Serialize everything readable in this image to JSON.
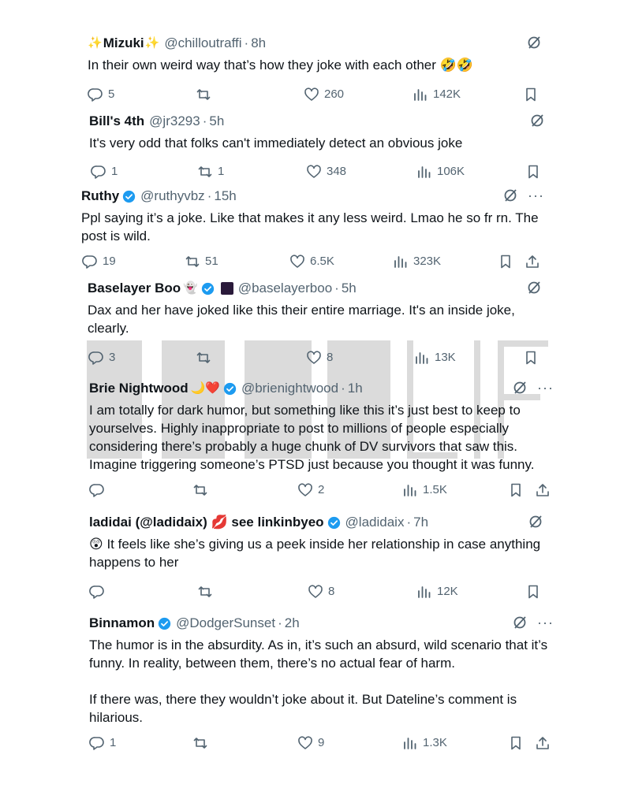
{
  "posts": [
    {
      "name": "Mizuki",
      "name_prefix_emoji": "✨",
      "name_suffix_emoji": "✨",
      "handle": "@chilloutraffi",
      "time": "8h",
      "text": "In their own weird way that’s how they joke with each other 🤣🤣",
      "replies": "5",
      "reposts": "",
      "likes": "260",
      "views": "142K",
      "verified": false,
      "show_more": false,
      "show_share": false
    },
    {
      "name": "Bill's 4th",
      "handle": "@jr3293",
      "time": "5h",
      "text": "It's very odd that folks can't immediately detect an obvious joke",
      "replies": "1",
      "reposts": "1",
      "likes": "348",
      "views": "106K",
      "verified": false,
      "show_more": false,
      "show_share": false
    },
    {
      "name": "Ruthy",
      "handle": "@ruthyvbz",
      "time": "15h",
      "text": "Ppl saying it’s a joke. Like that makes it any less weird. Lmao he so fr rn. The post is wild.",
      "replies": "19",
      "reposts": "51",
      "likes": "6.5K",
      "views": "323K",
      "verified": true,
      "show_more": true,
      "show_share": true
    },
    {
      "name": "Baselayer Boo",
      "name_suffix_emoji": "👻",
      "handle": "@baselayerboo",
      "time": "5h",
      "text": "Dax and her have joked like this their entire marriage. It's an inside joke, clearly.",
      "replies": "3",
      "reposts": "",
      "likes": "8",
      "views": "13K",
      "verified": true,
      "show_more": false,
      "show_share": false
    },
    {
      "name": "Brie Nightwood",
      "name_suffix_emoji": "🌙❤️",
      "handle": "@brienightwood",
      "time": "1h",
      "text": "I am totally for dark humor, but something like this it’s just best to keep to yourselves. Highly inappropriate to post to millions of people especially considering there’s probably a huge chunk of DV survivors that saw this. Imagine triggering someone’s PTSD just because you thought it was funny.",
      "replies": "",
      "reposts": "",
      "likes": "2",
      "views": "1.5K",
      "verified": true,
      "show_more": true,
      "show_share": true
    },
    {
      "name": "ladidai (@ladidaix) 💋 see linkinbyeo",
      "handle": "@ladidaix",
      "time": "7h",
      "text": "😲 It feels like she’s giving us a peek inside her relationship in case anything happens to her",
      "replies": "",
      "reposts": "",
      "likes": "8",
      "views": "12K",
      "verified": true,
      "show_more": false,
      "show_share": false
    },
    {
      "name": "Binnamon",
      "handle": "@DodgerSunset",
      "time": "2h",
      "text": "The humor is in the absurdity. As in, it’s such an absurd, wild scenario that it’s funny. In reality, between them, there’s no actual fear of harm.\n\nIf there was, there they wouldn’t joke about it. But Dateline’s comment is hilarious.",
      "replies": "1",
      "reposts": "",
      "likes": "9",
      "views": "1.3K",
      "verified": true,
      "show_more": true,
      "show_share": true
    }
  ],
  "ui": {
    "dot": "·",
    "more": "···"
  },
  "watermark": {
    "text": "JUSTNLIFE"
  },
  "colors": {
    "text": "#0f1419",
    "secondary": "#536471",
    "verified": "#1d9bf0"
  },
  "icons": {
    "reply": "reply-icon",
    "repost": "repost-icon",
    "like": "like-icon",
    "views": "views-icon",
    "bookmark": "bookmark-icon",
    "share": "share-icon",
    "grok": "grok-icon",
    "verified": "verified-badge-icon",
    "more": "more-icon"
  }
}
